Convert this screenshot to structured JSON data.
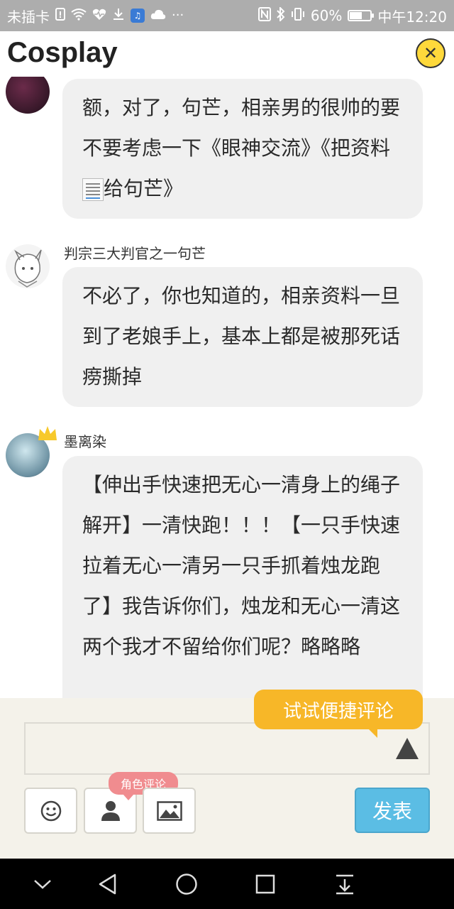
{
  "status_bar": {
    "carrier": "未插卡",
    "battery": "60%",
    "battery_level": 0.6,
    "time": "中午12:20",
    "icons": [
      "sim-warning-icon",
      "wifi-icon",
      "heart-rate-icon",
      "download-icon",
      "music-app-icon",
      "cloud-icon",
      "more-icon",
      "nfc-icon",
      "bluetooth-icon",
      "vibrate-icon",
      "battery-icon"
    ]
  },
  "header": {
    "title": "Cosplay",
    "close_icon": "close-icon"
  },
  "messages": [
    {
      "username": "",
      "text_parts": [
        "额，对了，句芒，相亲男的很帅的要不要考虑一下《眼神交流》《把资料",
        "给句芒》"
      ],
      "emoji": "document-emoji"
    },
    {
      "username": "判宗三大判官之一句芒",
      "text": "不必了，你也知道的，相亲资料一旦到了老娘手上，基本上都是被那死话痨撕掉"
    },
    {
      "username": "墨离染",
      "text": "【伸出手快速把无心一清身上的绳子解开】一清快跑！！！【一只手快速拉着无心一清另一只手抓着烛龙跑了】我告诉你们，烛龙和无心一清这两个我才不留给你们呢？略略略"
    }
  ],
  "composer": {
    "tip": "试试便捷评论",
    "input_value": "",
    "role_tag": "角色评论",
    "send_label": "发表",
    "colors": {
      "tip": "#f7b728",
      "role_tag": "#f08c8f",
      "send": "#5bbde4"
    }
  },
  "nav_bar": {
    "icons": [
      "chevron-down-icon",
      "back-icon",
      "home-icon",
      "recents-icon",
      "notification-pull-icon"
    ]
  }
}
